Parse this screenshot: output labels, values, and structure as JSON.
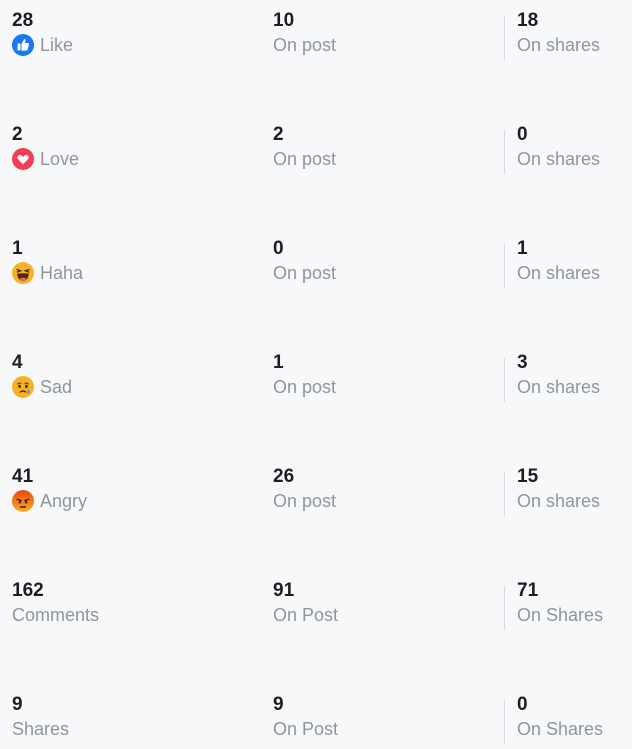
{
  "reactions": [
    {
      "key": "like",
      "total": "28",
      "label": "Like",
      "icon": "like-icon",
      "on_post": "10",
      "on_post_label": "On post",
      "on_shares": "18",
      "on_shares_label": "On shares"
    },
    {
      "key": "love",
      "total": "2",
      "label": "Love",
      "icon": "love-icon",
      "on_post": "2",
      "on_post_label": "On post",
      "on_shares": "0",
      "on_shares_label": "On shares"
    },
    {
      "key": "haha",
      "total": "1",
      "label": "Haha",
      "icon": "haha-icon",
      "on_post": "0",
      "on_post_label": "On post",
      "on_shares": "1",
      "on_shares_label": "On shares"
    },
    {
      "key": "sad",
      "total": "4",
      "label": "Sad",
      "icon": "sad-icon",
      "on_post": "1",
      "on_post_label": "On post",
      "on_shares": "3",
      "on_shares_label": "On shares"
    },
    {
      "key": "angry",
      "total": "41",
      "label": "Angry",
      "icon": "angry-icon",
      "on_post": "26",
      "on_post_label": "On post",
      "on_shares": "15",
      "on_shares_label": "On shares"
    },
    {
      "key": "comments",
      "total": "162",
      "label": "Comments",
      "icon": null,
      "on_post": "91",
      "on_post_label": "On Post",
      "on_shares": "71",
      "on_shares_label": "On Shares"
    },
    {
      "key": "shares",
      "total": "9",
      "label": "Shares",
      "icon": null,
      "on_post": "9",
      "on_post_label": "On Post",
      "on_shares": "0",
      "on_shares_label": "On Shares"
    }
  ],
  "colors": {
    "like": "#1877f2",
    "love": "#f33e58",
    "emoji_yellow": "#f7b125",
    "angry": "#e9710f",
    "tear": "#4c8cf5"
  }
}
